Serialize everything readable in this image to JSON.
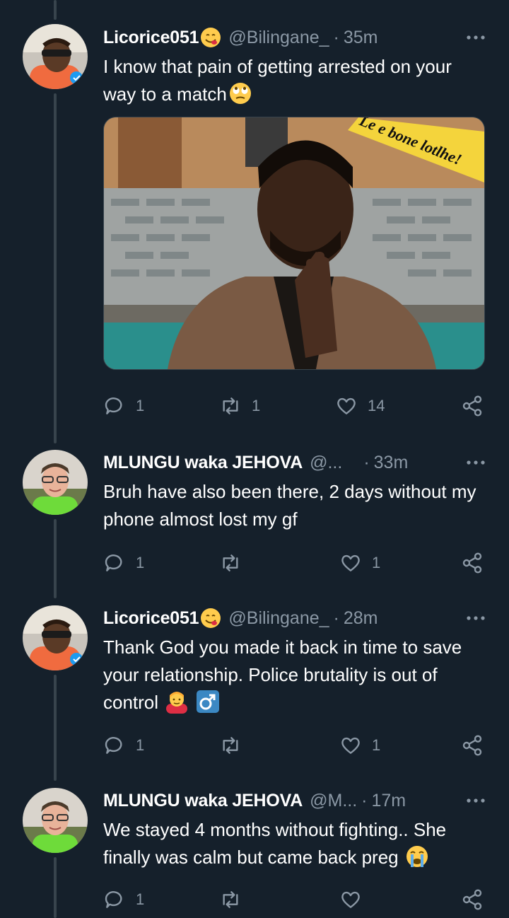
{
  "tweets": [
    {
      "name": "Licorice051",
      "handle": "@Bilingane_",
      "time": "35m",
      "text": "I know that pain of getting arrested on your way to a match",
      "name_emoji": "yum-face-emoji",
      "text_emoji": "rolling-eyes-emoji",
      "media": {
        "caption": "Le e bone lotlhe!"
      },
      "replies": "1",
      "retweets": "1",
      "likes": "14"
    },
    {
      "name": "MLUNGU waka JEHOVA",
      "handle": "@...",
      "time": "33m",
      "text": "Bruh have also been there, 2 days without my phone almost lost my gf",
      "replies": "1",
      "retweets": "",
      "likes": "1"
    },
    {
      "name": "Licorice051",
      "handle": "@Bilingane_",
      "time": "28m",
      "text": "Thank God you made it back in time to save your relationship. Police brutality is out of control",
      "name_emoji": "yum-face-emoji",
      "text_emoji": "person-gesturing-emoji",
      "text_emoji_2": "male-sign-emoji",
      "replies": "1",
      "retweets": "",
      "likes": "1"
    },
    {
      "name": "MLUNGU waka JEHOVA",
      "handle": "@M...",
      "time": "17m",
      "text": "We stayed 4 months without fighting.. She finally was calm but came back preg",
      "text_emoji": "crying-face-emoji",
      "replies": "1",
      "retweets": "",
      "likes": ""
    }
  ],
  "colors": {
    "background": "#15202b",
    "muted": "#8b98a5",
    "thread_line": "#38444d"
  }
}
